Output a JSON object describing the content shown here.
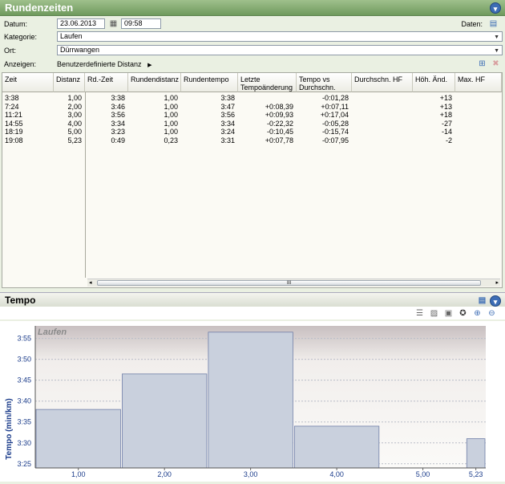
{
  "title": "Rundenzeiten",
  "datum": {
    "label": "Datum:",
    "date": "23.06.2013",
    "time": "09:58"
  },
  "daten_label": "Daten:",
  "kategorie": {
    "label": "Kategorie:",
    "value": "Laufen"
  },
  "ort": {
    "label": "Ort:",
    "value": "Dürrwangen"
  },
  "anzeigen": {
    "label": "Anzeigen:",
    "value": "Benutzerdefinierte Distanz"
  },
  "columns": [
    "Zeit",
    "Distanz",
    "Rd.-Zeit",
    "Rundendistanz",
    "Rundentempo",
    "Letzte Tempoänderung",
    "Tempo vs Durchschn.",
    "Durchschn. HF",
    "Höh. Änd.",
    "Max. HF"
  ],
  "rows": [
    [
      "3:38",
      "1,00",
      "3:38",
      "1,00",
      "3:38",
      "",
      "-0:01,28",
      "",
      "+13",
      ""
    ],
    [
      "7:24",
      "2,00",
      "3:46",
      "1,00",
      "3:47",
      "+0:08,39",
      "+0:07,11",
      "",
      "+13",
      ""
    ],
    [
      "11:21",
      "3,00",
      "3:56",
      "1,00",
      "3:56",
      "+0:09,93",
      "+0:17,04",
      "",
      "+18",
      ""
    ],
    [
      "14:55",
      "4,00",
      "3:34",
      "1,00",
      "3:34",
      "-0:22,32",
      "-0:05,28",
      "",
      "-27",
      ""
    ],
    [
      "18:19",
      "5,00",
      "3:23",
      "1,00",
      "3:24",
      "-0:10,45",
      "-0:15,74",
      "",
      "-14",
      ""
    ],
    [
      "19:08",
      "5,23",
      "0:49",
      "0,23",
      "3:31",
      "+0:07,78",
      "-0:07,95",
      "",
      "-2",
      ""
    ]
  ],
  "scroll_label": "III",
  "tempo_title": "Tempo",
  "chart_data": {
    "type": "bar",
    "title": "Laufen",
    "xlabel": "",
    "ylabel": "Tempo (min/km)",
    "categories": [
      "1,00",
      "2,00",
      "3,00",
      "4,00",
      "5,00",
      "5,23"
    ],
    "values": [
      218,
      226.5,
      236.5,
      214,
      204,
      211
    ],
    "value_labels": [
      "3:38",
      "3:46,5",
      "3:56,5",
      "3:34",
      "3:24",
      "3:31"
    ],
    "yticks": [
      {
        "v": 205,
        "label": "3:25"
      },
      {
        "v": 210,
        "label": "3:30"
      },
      {
        "v": 215,
        "label": "3:35"
      },
      {
        "v": 220,
        "label": "3:40"
      },
      {
        "v": 225,
        "label": "3:45"
      },
      {
        "v": 230,
        "label": "3:50"
      },
      {
        "v": 235,
        "label": "3:55"
      }
    ],
    "ylim": [
      204,
      238
    ],
    "bar_color": "#c9d0dd",
    "bar_border": "#6f7ea8"
  }
}
